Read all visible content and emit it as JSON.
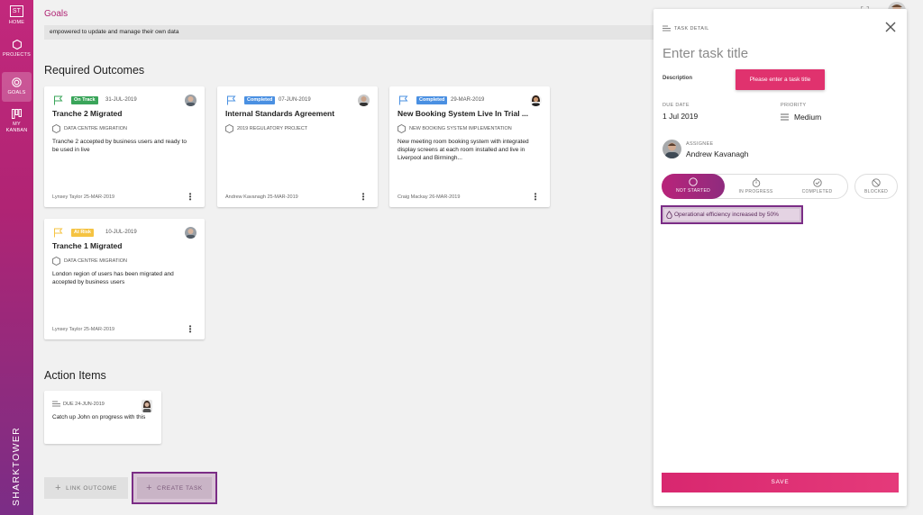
{
  "sidebar": {
    "logo_text": "ST",
    "items": [
      {
        "label": "HOME"
      },
      {
        "label": "PROJECTS"
      },
      {
        "label": "GOALS"
      },
      {
        "label": "MY KANBAN"
      }
    ],
    "brand": "SHARKTOWER"
  },
  "page": {
    "title": "Goals",
    "description_excerpt": "empowered to update and manage their own data"
  },
  "sections": {
    "required_outcomes": "Required Outcomes",
    "action_items": "Action Items"
  },
  "outcomes": [
    {
      "status": "On Track",
      "status_color": "#3aa55a",
      "flag_color": "#3aa55a",
      "date": "31-JUL-2019",
      "title": "Tranche 2 Migrated",
      "project": "DATA CENTRE MIGRATION",
      "body": "Tranche 2 accepted by business users and ready to be used in live",
      "footer": "Lynsey Taylor 25-MAR-2019"
    },
    {
      "status": "Completed",
      "status_color": "#4a90e2",
      "flag_color": "#4a90e2",
      "date": "07-JUN-2019",
      "title": "Internal Standards Agreement",
      "project": "2019 REGULATORY PROJECT",
      "body": "",
      "footer": "Andrew Kavanagh 25-MAR-2019"
    },
    {
      "status": "Completed",
      "status_color": "#4a90e2",
      "flag_color": "#4a90e2",
      "date": "29-MAR-2019",
      "title": "New Booking System Live In Trial ...",
      "project": "NEW BOOKING SYSTEM IMPLEMENTATION",
      "body": "New meeting room booking system with integrated display screens at each room installed and live in Liverpool and Birmingh...",
      "footer": "Craig Mackay 26-MAR-2019"
    },
    {
      "status": "At Risk",
      "status_color": "#f5c342",
      "flag_color": "#f5c342",
      "date": "10-JUL-2019",
      "title": "Tranche 1 Migrated",
      "project": "DATA CENTRE MIGRATION",
      "body": "London region of users has been migrated and accepted by business users",
      "footer": "Lynsey Taylor 25-MAR-2019"
    }
  ],
  "action_items": [
    {
      "due": "DUE 24-JUN-2019",
      "text": "Catch up John on progress with this"
    }
  ],
  "buttons": {
    "link_outcome": "LINK OUTCOME",
    "create_task": "CREATE TASK"
  },
  "task_panel": {
    "header": "TASK DETAIL",
    "title_placeholder": "Enter task title",
    "description_label": "Description",
    "tooltip": "Please enter a task title",
    "due_label": "DUE DATE",
    "due_value": "1 Jul 2019",
    "priority_label": "PRIORITY",
    "priority_value": "Medium",
    "assignee_label": "ASSIGNEE",
    "assignee_name": "Andrew Kavanagh",
    "statuses": [
      "NOT STARTED",
      "IN PROGRESS",
      "COMPLETED",
      "BLOCKED"
    ],
    "active_status": "NOT STARTED",
    "linked_outcome": "Operational efficiency increased by 50%",
    "save_label": "SAVE"
  },
  "colors": {
    "brand": "#b02474",
    "accent_purple": "#7b2d86",
    "save": "#e0326e"
  }
}
